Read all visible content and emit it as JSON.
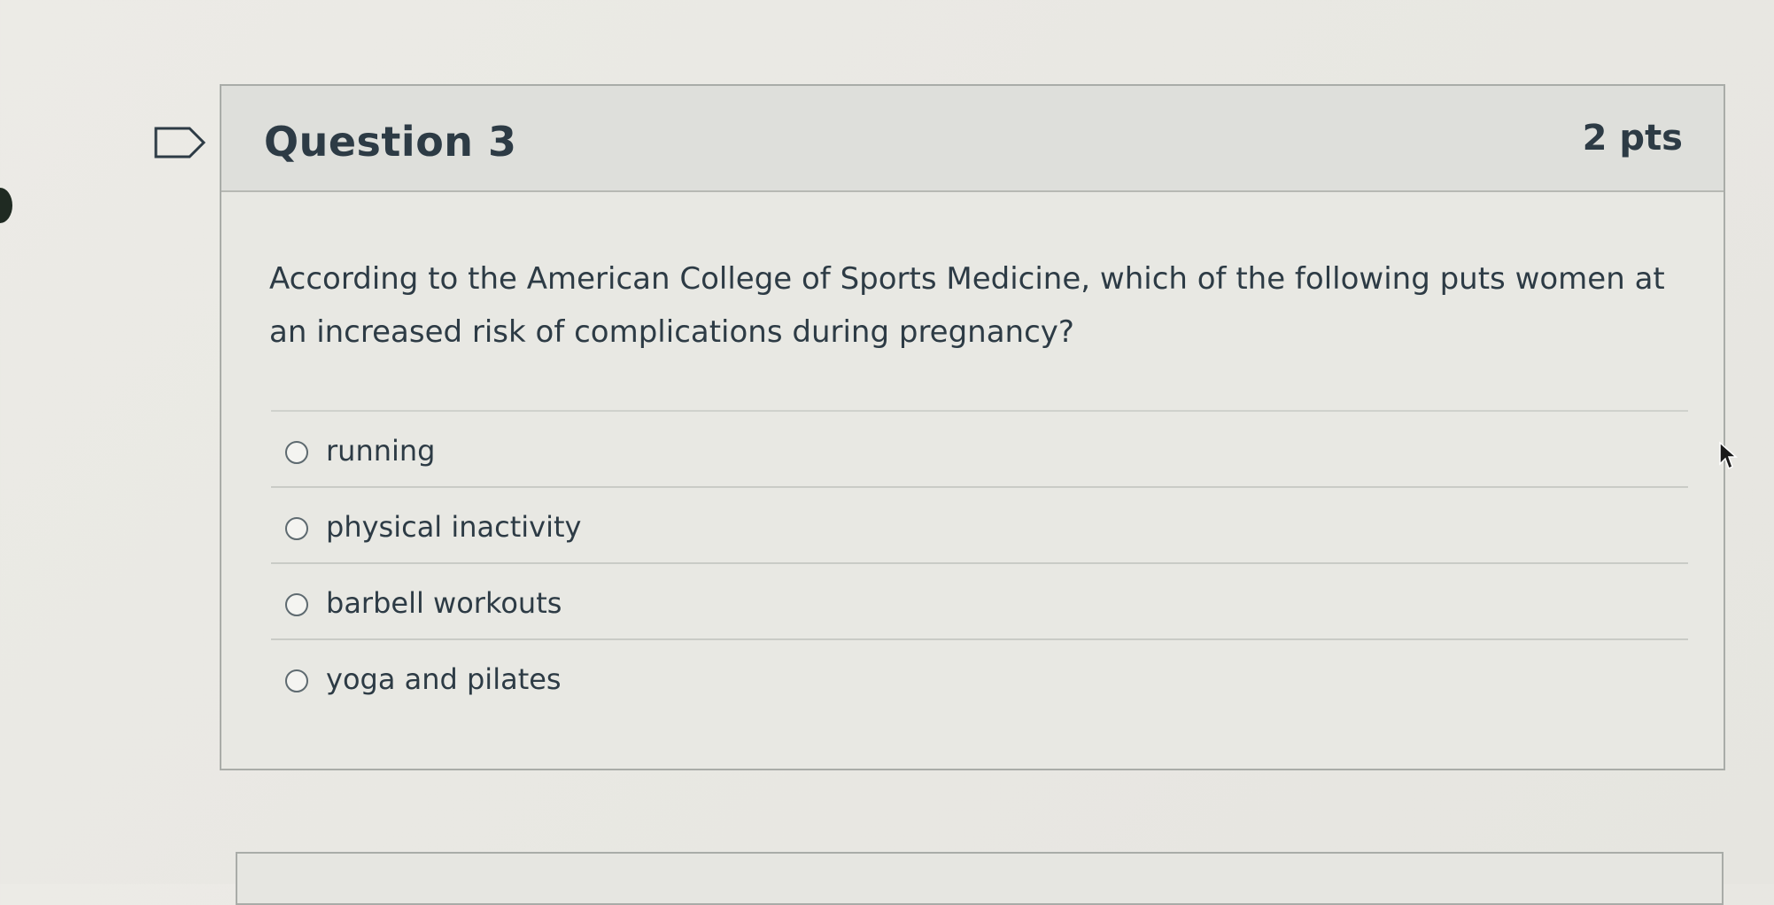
{
  "question": {
    "title": "Question 3",
    "points": "2 pts",
    "text": "According to the American College of Sports Medicine, which of the following puts women at an increased risk of complications during pregnancy?",
    "flag_icon": "bookmark-flag-icon"
  },
  "answers": [
    {
      "label": "running",
      "selected": false
    },
    {
      "label": "physical inactivity",
      "selected": false
    },
    {
      "label": "barbell workouts",
      "selected": false
    },
    {
      "label": "yoga and pilates",
      "selected": false
    }
  ],
  "colors": {
    "text": "#2d3b45",
    "header_bg": "#dedfdb",
    "card_bg": "#e8e8e3",
    "border": "#a9aca8"
  }
}
